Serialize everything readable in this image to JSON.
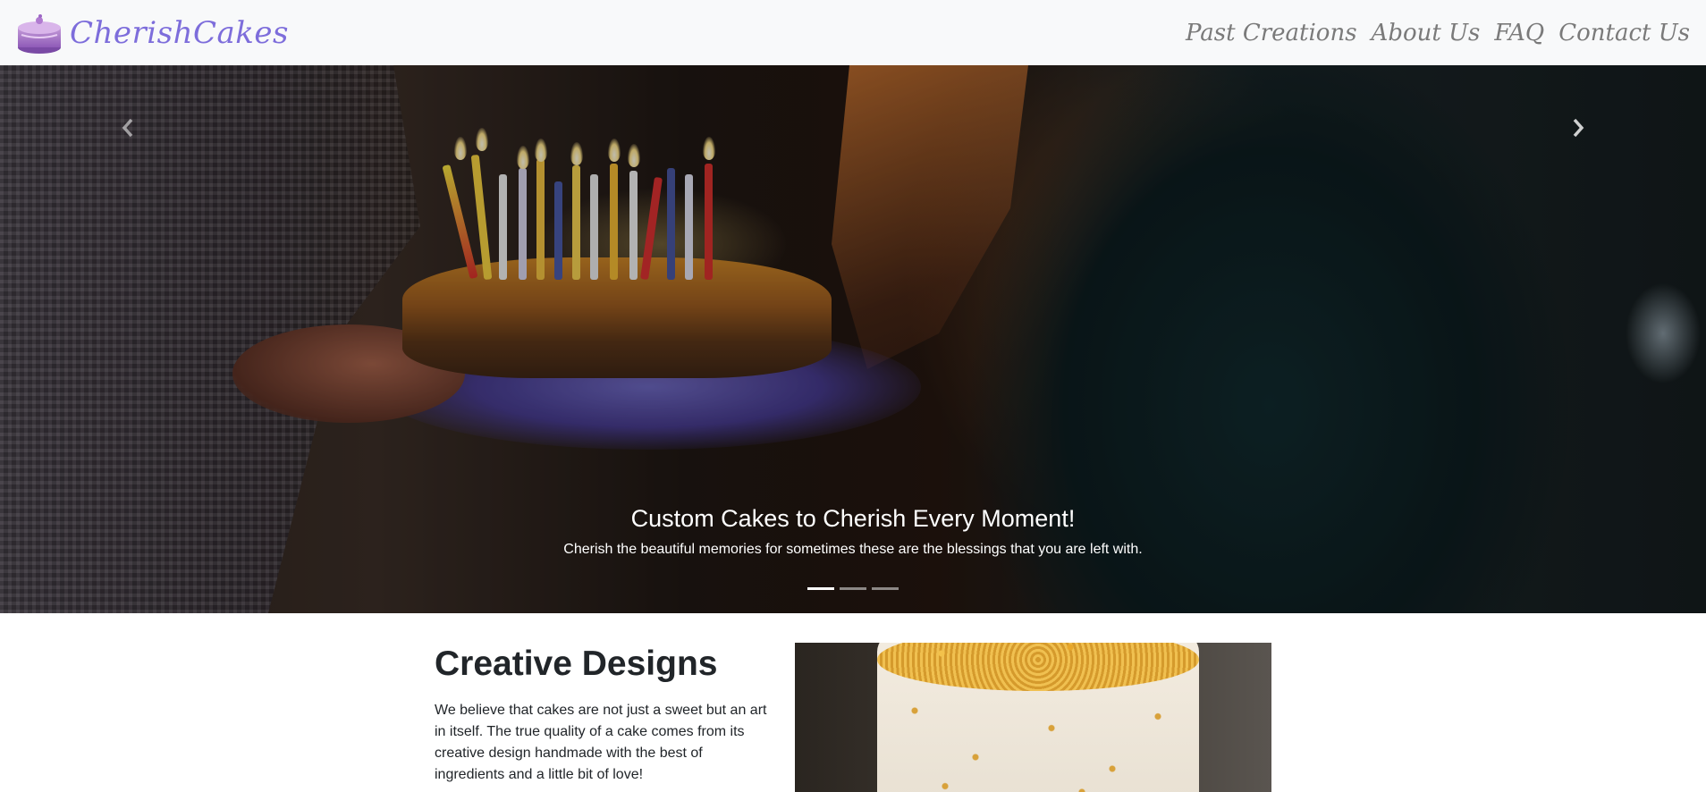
{
  "navbar": {
    "brand_name": "CherishCakes",
    "brand_icon": "cake-icon",
    "links": [
      {
        "label": "Past Creations"
      },
      {
        "label": "About Us"
      },
      {
        "label": "FAQ"
      },
      {
        "label": "Contact Us"
      }
    ]
  },
  "carousel": {
    "caption_title": "Custom Cakes to Cherish Every Moment!",
    "caption_text": "Cherish the beautiful memories for sometimes these are the blessings that you are left with.",
    "prev_icon": "chevron-left-icon",
    "next_icon": "chevron-right-icon",
    "slide_count": 3,
    "active_slide": 1
  },
  "section": {
    "title": "Creative Designs",
    "text": "We believe that cakes are not just a sweet but an art in itself. The true quality of a cake comes from its creative design handmade with the best of ingredients and a little bit of love!"
  },
  "colors": {
    "brand": "#7d6ddb",
    "nav_link": "#7a7a7a",
    "navbar_bg": "#f8f9fa"
  }
}
